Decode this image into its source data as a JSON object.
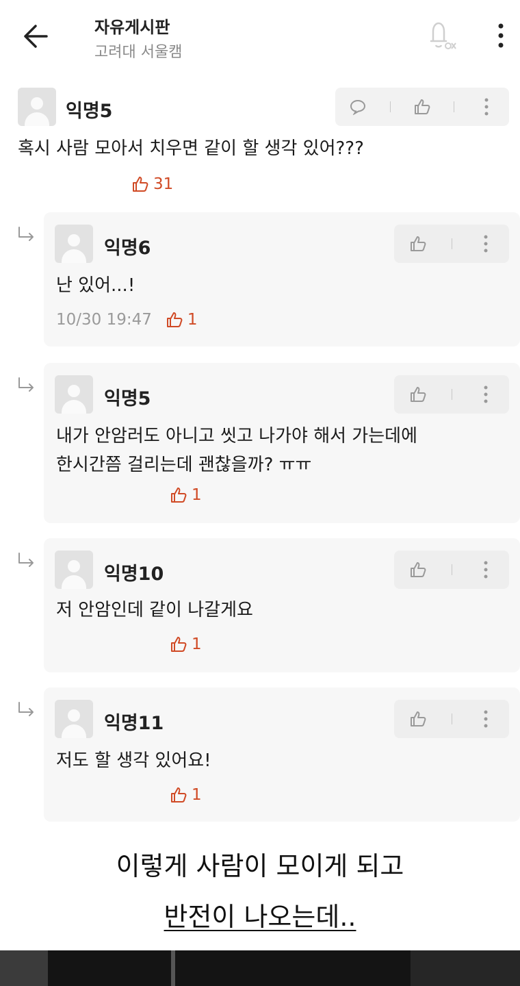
{
  "header": {
    "title": "자유게시판",
    "subtitle": "고려대 서울캠"
  },
  "comments": [
    {
      "author": "익명5",
      "text": "혹시 사람 모아서 치우면 같이 할 생각 있어???",
      "likes": "31",
      "time": ""
    },
    {
      "author": "익명6",
      "text": "난 있어...!",
      "likes": "1",
      "time": "10/30 19:47"
    },
    {
      "author": "익명5",
      "text": "내가 안암러도 아니고 씻고 나가야 해서 가는데에\n한시간쯤 걸리는데 괜찮을까? ㅠㅠ",
      "likes": "1",
      "time": ""
    },
    {
      "author": "익명10",
      "text": "저 안암인데 같이 나갈게요",
      "likes": "1",
      "time": ""
    },
    {
      "author": "익명11",
      "text": "저도 할 생각 있어요!",
      "likes": "1",
      "time": ""
    }
  ],
  "caption": {
    "line1": "이렇게 사람이 모이게 되고",
    "line2": "반전이 나오는데.."
  },
  "colors": {
    "like": "#d04a25",
    "reply_bg": "#f7f7f7"
  }
}
